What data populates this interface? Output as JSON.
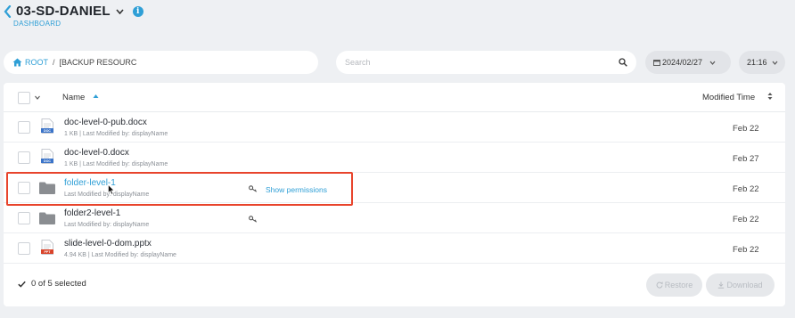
{
  "header": {
    "title": "03-SD-DANIEL",
    "subtitle": "DASHBOARD",
    "info_icon": "i"
  },
  "breadcrumb": {
    "root": "ROOT",
    "separator": "/",
    "current": "[BACKUP RESOURC"
  },
  "search": {
    "placeholder": "Search",
    "value": ""
  },
  "date_picker": {
    "value": "2024/02/27"
  },
  "time_picker": {
    "value": "21:16"
  },
  "table": {
    "columns": {
      "name": "Name",
      "modified": "Modified Time"
    },
    "rows": [
      {
        "title": "doc-level-0-pub.docx",
        "meta": "1 KB | Last Modified by: displayName",
        "date": "Feb 22",
        "type": "doc",
        "icon_label": "DOC"
      },
      {
        "title": "doc-level-0.docx",
        "meta": "1 KB | Last Modified by: displayName",
        "date": "Feb 27",
        "type": "doc",
        "icon_label": "DOC"
      },
      {
        "title": "folder-level-1",
        "meta": "Last Modified by: displayName",
        "date": "Feb 22",
        "type": "folder",
        "action": "Show permissions"
      },
      {
        "title": "folder2-level-1",
        "meta": "Last Modified by: displayName",
        "date": "Feb 22",
        "type": "folder"
      },
      {
        "title": "slide-level-0-dom.pptx",
        "meta": "4.94 KB | Last Modified by: displayName",
        "date": "Feb 22",
        "type": "ppt",
        "icon_label": "PPT"
      }
    ]
  },
  "footer": {
    "selected": "0 of 5 selected",
    "restore_label": "Restore",
    "download_label": "Download"
  },
  "colors": {
    "accent": "#2f9fd6",
    "highlight": "#e8442c",
    "doc_icon": "#3b74c9",
    "ppt_icon": "#d9442b",
    "folder": "#8a8d91"
  }
}
